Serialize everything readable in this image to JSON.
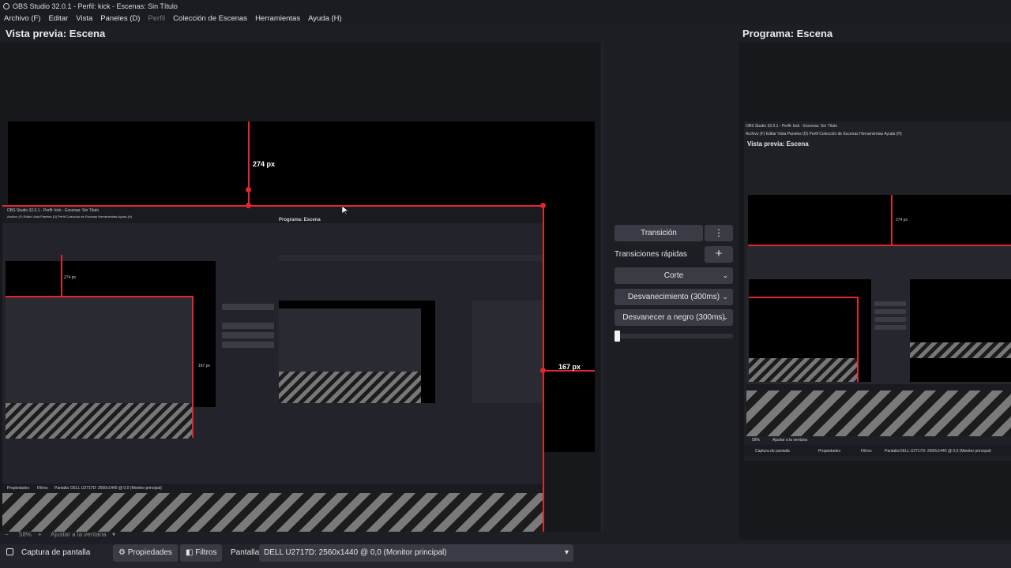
{
  "window": {
    "title": "OBS Studio 32.0.1 - Perfil: kick - Escenas: Sin Título"
  },
  "menu": [
    {
      "label": "Archivo (F)",
      "enabled": true
    },
    {
      "label": "Editar",
      "enabled": true
    },
    {
      "label": "Vista",
      "enabled": true
    },
    {
      "label": "Paneles (D)",
      "enabled": true
    },
    {
      "label": "Perfil",
      "enabled": false
    },
    {
      "label": "Colección de Escenas",
      "enabled": true
    },
    {
      "label": "Herramientas",
      "enabled": true
    },
    {
      "label": "Ayuda (H)",
      "enabled": true
    }
  ],
  "preview": {
    "title": "Vista previa: Escena",
    "guide_top_label": "274 px",
    "guide_right_label": "167 px",
    "zoom_label": "58%",
    "zoom_minus": "−",
    "zoom_plus": "+",
    "fit_label": "Ajustar a la ventana"
  },
  "program": {
    "title": "Programa: Escena"
  },
  "transitions": {
    "transition_button": "Transición",
    "quick_label": "Transiciones rápidas",
    "quick_items": [
      "Corte",
      "Desvanecimiento (300ms)",
      "Desvanecer a negro (300ms)"
    ],
    "slider_value": 0
  },
  "source_bar": {
    "source_name": "Captura de pantalla",
    "properties_label": "Propiedades",
    "filters_label": "Filtros",
    "display_label": "Pantalla",
    "display_value": "DELL U2717D: 2560x1440 @ 0,0 (Monitor principal)"
  },
  "nested_preview": {
    "title": "Vista previa: Escena",
    "program_title": "Programa: Escena",
    "guide_top_label": "274 px",
    "guide_right_label": "167 px",
    "menu_text": "Archivo (F)   Editar   Vista   Paneles (D)   Perfil   Colección de Escenas   Herramientas   Ayuda (H)",
    "window_title": "OBS Studio 32.0.1 - Perfil: kick - Escenas: Sin Título",
    "source_name": "Captura de pantalla",
    "properties_label": "Propiedades",
    "filters_label": "Filtros",
    "display_label": "Pantalla",
    "display_value": "DELL U2717D: 2560x1440 @ 0,0 (Monitor principal)",
    "zoom_label": "58%",
    "fit_label": "Ajustar a la ventana"
  },
  "colors": {
    "guide_red": "#e1262c",
    "background": "#1d1e24",
    "button": "#3a3b45"
  }
}
